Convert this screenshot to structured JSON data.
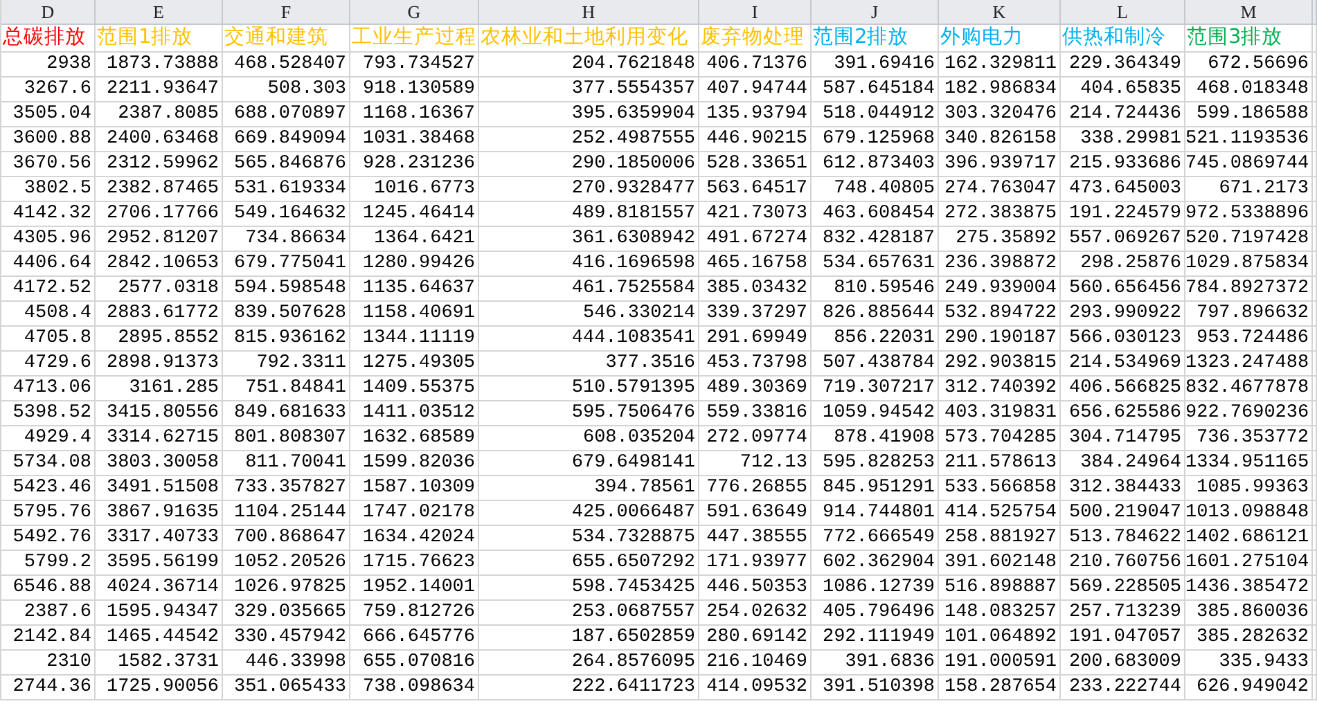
{
  "columns": [
    {
      "letter": "D",
      "header": "总碳排放",
      "color": "#ff0000"
    },
    {
      "letter": "E",
      "header": "范围1排放",
      "color": "#ffc000"
    },
    {
      "letter": "F",
      "header": "交通和建筑",
      "color": "#ffc000"
    },
    {
      "letter": "G",
      "header": "工业生产过程",
      "color": "#ffc000"
    },
    {
      "letter": "H",
      "header": "农林业和土地利用变化",
      "color": "#ffc000"
    },
    {
      "letter": "I",
      "header": "废弃物处理",
      "color": "#ffc000"
    },
    {
      "letter": "J",
      "header": "范围2排放",
      "color": "#00b0f0"
    },
    {
      "letter": "K",
      "header": "外购电力",
      "color": "#00b0f0"
    },
    {
      "letter": "L",
      "header": "供热和制冷",
      "color": "#00b0f0"
    },
    {
      "letter": "M",
      "header": "范围3排放",
      "color": "#00b050"
    }
  ],
  "rows": [
    [
      "2938",
      "1873.73888",
      "468.528407",
      "793.734527",
      "204.7621848",
      "406.71376",
      "391.69416",
      "162.329811",
      "229.364349",
      "672.56696"
    ],
    [
      "3267.6",
      "2211.93647",
      "508.303",
      "918.130589",
      "377.5554357",
      "407.94744",
      "587.645184",
      "182.986834",
      "404.65835",
      "468.018348"
    ],
    [
      "3505.04",
      "2387.8085",
      "688.070897",
      "1168.16367",
      "395.6359904",
      "135.93794",
      "518.044912",
      "303.320476",
      "214.724436",
      "599.186588"
    ],
    [
      "3600.88",
      "2400.63468",
      "669.849094",
      "1031.38468",
      "252.4987555",
      "446.90215",
      "679.125968",
      "340.826158",
      "338.29981",
      "521.1193536"
    ],
    [
      "3670.56",
      "2312.59962",
      "565.846876",
      "928.231236",
      "290.1850006",
      "528.33651",
      "612.873403",
      "396.939717",
      "215.933686",
      "745.0869744"
    ],
    [
      "3802.5",
      "2382.87465",
      "531.619334",
      "1016.6773",
      "270.9328477",
      "563.64517",
      "748.40805",
      "274.763047",
      "473.645003",
      "671.2173"
    ],
    [
      "4142.32",
      "2706.17766",
      "549.164632",
      "1245.46414",
      "489.8181557",
      "421.73073",
      "463.608454",
      "272.383875",
      "191.224579",
      "972.5338896"
    ],
    [
      "4305.96",
      "2952.81207",
      "734.86634",
      "1364.6421",
      "361.6308942",
      "491.67274",
      "832.428187",
      "275.35892",
      "557.069267",
      "520.7197428"
    ],
    [
      "4406.64",
      "2842.10653",
      "679.775041",
      "1280.99426",
      "416.1696598",
      "465.16758",
      "534.657631",
      "236.398872",
      "298.25876",
      "1029.875834"
    ],
    [
      "4172.52",
      "2577.0318",
      "594.598548",
      "1135.64637",
      "461.7525584",
      "385.03432",
      "810.59546",
      "249.939004",
      "560.656456",
      "784.8927372"
    ],
    [
      "4508.4",
      "2883.61772",
      "839.507628",
      "1158.40691",
      "546.330214",
      "339.37297",
      "826.885644",
      "532.894722",
      "293.990922",
      "797.896632"
    ],
    [
      "4705.8",
      "2895.8552",
      "815.936162",
      "1344.11119",
      "444.1083541",
      "291.69949",
      "856.22031",
      "290.190187",
      "566.030123",
      "953.724486"
    ],
    [
      "4729.6",
      "2898.91373",
      "792.3311",
      "1275.49305",
      "377.3516",
      "453.73798",
      "507.438784",
      "292.903815",
      "214.534969",
      "1323.247488"
    ],
    [
      "4713.06",
      "3161.285",
      "751.84841",
      "1409.55375",
      "510.5791395",
      "489.30369",
      "719.307217",
      "312.740392",
      "406.566825",
      "832.4677878"
    ],
    [
      "5398.52",
      "3415.80556",
      "849.681633",
      "1411.03512",
      "595.7506476",
      "559.33816",
      "1059.94542",
      "403.319831",
      "656.625586",
      "922.7690236"
    ],
    [
      "4929.4",
      "3314.62715",
      "801.808307",
      "1632.68589",
      "608.035204",
      "272.09774",
      "878.41908",
      "573.704285",
      "304.714795",
      "736.353772"
    ],
    [
      "5734.08",
      "3803.30058",
      "811.70041",
      "1599.82036",
      "679.6498141",
      "712.13",
      "595.828253",
      "211.578613",
      "384.24964",
      "1334.951165"
    ],
    [
      "5423.46",
      "3491.51508",
      "733.357827",
      "1587.10309",
      "394.78561",
      "776.26855",
      "845.951291",
      "533.566858",
      "312.384433",
      "1085.99363"
    ],
    [
      "5795.76",
      "3867.91635",
      "1104.25144",
      "1747.02178",
      "425.0066487",
      "591.63649",
      "914.744801",
      "414.525754",
      "500.219047",
      "1013.098848"
    ],
    [
      "5492.76",
      "3317.40733",
      "700.868647",
      "1634.42024",
      "534.7328875",
      "447.38555",
      "772.666549",
      "258.881927",
      "513.784622",
      "1402.686121"
    ],
    [
      "5799.2",
      "3595.56199",
      "1052.20526",
      "1715.76623",
      "655.6507292",
      "171.93977",
      "602.362904",
      "391.602148",
      "210.760756",
      "1601.275104"
    ],
    [
      "6546.88",
      "4024.36714",
      "1026.97825",
      "1952.14001",
      "598.7453425",
      "446.50353",
      "1086.12739",
      "516.898887",
      "569.228505",
      "1436.385472"
    ],
    [
      "2387.6",
      "1595.94347",
      "329.035665",
      "759.812726",
      "253.0687557",
      "254.02632",
      "405.796496",
      "148.083257",
      "257.713239",
      "385.860036"
    ],
    [
      "2142.84",
      "1465.44542",
      "330.457942",
      "666.645776",
      "187.6502859",
      "280.69142",
      "292.111949",
      "101.064892",
      "191.047057",
      "385.282632"
    ],
    [
      "2310",
      "1582.3731",
      "446.33998",
      "655.070816",
      "264.8576095",
      "216.10469",
      "391.6836",
      "191.000591",
      "200.683009",
      "335.9433"
    ],
    [
      "2744.36",
      "1725.90056",
      "351.065433",
      "738.098634",
      "222.6411723",
      "414.09532",
      "391.510398",
      "158.287654",
      "233.222744",
      "626.949042"
    ]
  ]
}
